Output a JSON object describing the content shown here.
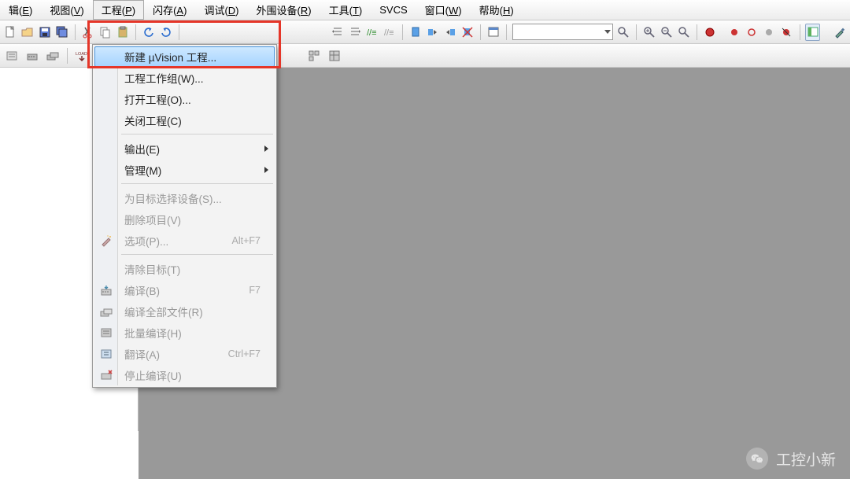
{
  "menubar": {
    "items": [
      {
        "label": "辑",
        "mn": "E"
      },
      {
        "label": "视图",
        "mn": "V"
      },
      {
        "label": "工程",
        "mn": "P"
      },
      {
        "label": "闪存",
        "mn": "A"
      },
      {
        "label": "调试",
        "mn": "D"
      },
      {
        "label": "外围设备",
        "mn": "R"
      },
      {
        "label": "工具",
        "mn": "T"
      },
      {
        "label": "SVCS",
        "mn": ""
      },
      {
        "label": "窗口",
        "mn": "W"
      },
      {
        "label": "帮助",
        "mn": "H"
      }
    ]
  },
  "dropdown": {
    "items": [
      {
        "label": "新建 µVision 工程...",
        "mn": "",
        "highlight": true
      },
      {
        "label": "工程工作组",
        "mn": "W",
        "suffix": "..."
      },
      {
        "label": "打开工程",
        "mn": "O",
        "suffix": "..."
      },
      {
        "label": "关闭工程",
        "mn": "C"
      },
      {
        "sep": true
      },
      {
        "label": "输出",
        "mn": "E",
        "submenu": true
      },
      {
        "label": "管理",
        "mn": "M",
        "submenu": true
      },
      {
        "sep": true
      },
      {
        "label": "为目标选择设备",
        "mn": "S",
        "suffix": "...",
        "disabled": true
      },
      {
        "label": "删除项目",
        "mn": "V",
        "disabled": true
      },
      {
        "label": "选项",
        "mn": "P",
        "suffix": "...",
        "shortcut": "Alt+F7",
        "disabled": true,
        "icon": "wand"
      },
      {
        "sep": true
      },
      {
        "label": "清除目标",
        "mn": "T",
        "disabled": true
      },
      {
        "label": "编译",
        "mn": "B",
        "shortcut": "F7",
        "disabled": true,
        "icon": "build"
      },
      {
        "label": "编译全部文件",
        "mn": "R",
        "disabled": true,
        "icon": "buildall"
      },
      {
        "label": "批量编译",
        "mn": "H",
        "disabled": true,
        "icon": "batch"
      },
      {
        "label": "翻译",
        "mn": "A",
        "shortcut": "Ctrl+F7",
        "disabled": true,
        "icon": "translate"
      },
      {
        "label": "停止编译",
        "mn": "U",
        "disabled": true,
        "icon": "stop"
      }
    ]
  },
  "toolbar2": {
    "load": "LOAD"
  },
  "watermark": {
    "text": "工控小新"
  }
}
